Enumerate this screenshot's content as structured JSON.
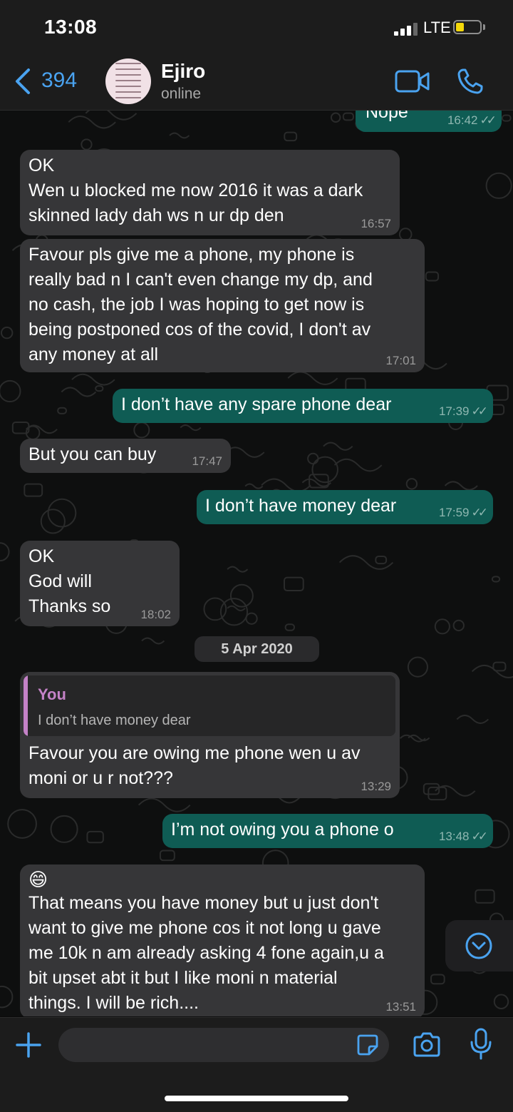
{
  "status_bar": {
    "time": "13:08",
    "network": "LTE",
    "signal_bars": 3,
    "signal_max": 4,
    "battery_level": 0.35
  },
  "header": {
    "back_count": "394",
    "contact_name": "Ejiro",
    "contact_status": "online",
    "icons": [
      "chevron-left-icon",
      "video-call-icon",
      "phone-icon"
    ]
  },
  "messages": [
    {
      "direction": "out",
      "text": "Nope",
      "time": "16:42",
      "status": "read"
    },
    {
      "direction": "in",
      "text": "OK\nWen u blocked me now 2016 it was a dark\nskinned lady dah ws n ur dp den",
      "time": "16:57"
    },
    {
      "direction": "in",
      "text": "Favour pls give me a phone, my phone is\nreally bad n I can't even change my dp, and\nno cash, the job I was hoping to get now is\nbeing postponed cos of the covid, I don't av\nany money at all",
      "time": "17:01"
    },
    {
      "direction": "out",
      "text": "I don’t have any spare phone dear",
      "time": "17:39",
      "status": "read"
    },
    {
      "direction": "in",
      "text": "But you can buy",
      "time": "17:47"
    },
    {
      "direction": "out",
      "text": "I don’t have money dear",
      "time": "17:59",
      "status": "read"
    },
    {
      "direction": "in",
      "text": "OK\nGod will\nThanks so",
      "time": "18:02"
    },
    {
      "direction": "in",
      "text": "Favour you are owing me phone wen u av\nmoni or u r not???",
      "time": "13:29",
      "quote": {
        "author": "You",
        "text": "I don’t have money dear"
      }
    },
    {
      "direction": "out",
      "text": "I’m not owing you a phone o",
      "time": "13:48",
      "status": "read"
    },
    {
      "direction": "in",
      "emoji": "😄",
      "text": "That means you have money but u just don't\nwant to give me phone cos it not long u gave\nme 10k n am already asking 4 fone again,u a\nbit upset abt it but I like moni n material\nthings. I will be rich....",
      "time": "13:51"
    }
  ],
  "date_separator": "5 Apr 2020",
  "composer": {
    "placeholder": "",
    "icons": [
      "plus-icon",
      "sticker-icon",
      "camera-icon",
      "microphone-icon"
    ]
  },
  "scroll_button_icon": "chevron-down-circle-icon",
  "colors": {
    "incoming_bubble": "#363638",
    "outgoing_bubble": "#0f5c54",
    "accent": "#4aa3f0",
    "quote_author": "#c482c7",
    "read_ticks": "#8fb7b1"
  }
}
